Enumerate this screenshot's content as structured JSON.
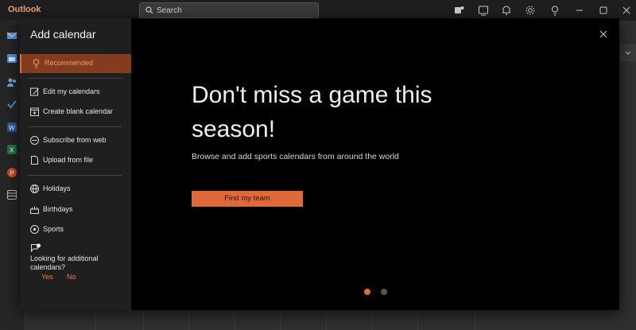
{
  "app": {
    "title": "Outlook"
  },
  "search": {
    "label": "Search"
  },
  "dialog": {
    "title": "Add calendar",
    "nav_groups": [
      [
        {
          "label": "Recommended",
          "icon": "lightbulb-icon",
          "active": true
        }
      ],
      [
        {
          "label": "Edit my calendars",
          "icon": "edit-calendar-icon"
        },
        {
          "label": "Create blank calendar",
          "icon": "blank-calendar-icon"
        }
      ],
      [
        {
          "label": "Subscribe from web",
          "icon": "subscribe-web-icon"
        },
        {
          "label": "Upload from file",
          "icon": "upload-file-icon"
        }
      ],
      [
        {
          "label": "Holidays",
          "icon": "globe-icon"
        },
        {
          "label": "Birthdays",
          "icon": "cake-icon"
        },
        {
          "label": "Sports",
          "icon": "ball-icon"
        }
      ]
    ],
    "feedback": {
      "question": "Looking for additional calendars?",
      "yes": "Yes",
      "no": "No"
    },
    "content": {
      "headline": "Don't miss a game this season!",
      "subtext": "Browse and add sports calendars from around the world",
      "cta": "Find my team"
    },
    "pager": {
      "count": 2,
      "active_index": 0
    }
  },
  "colors": {
    "accent": "#e0693a",
    "active_bg": "#823c1f",
    "dialog_bg": "#000000",
    "sidebar_bg": "#1f1f1f"
  }
}
